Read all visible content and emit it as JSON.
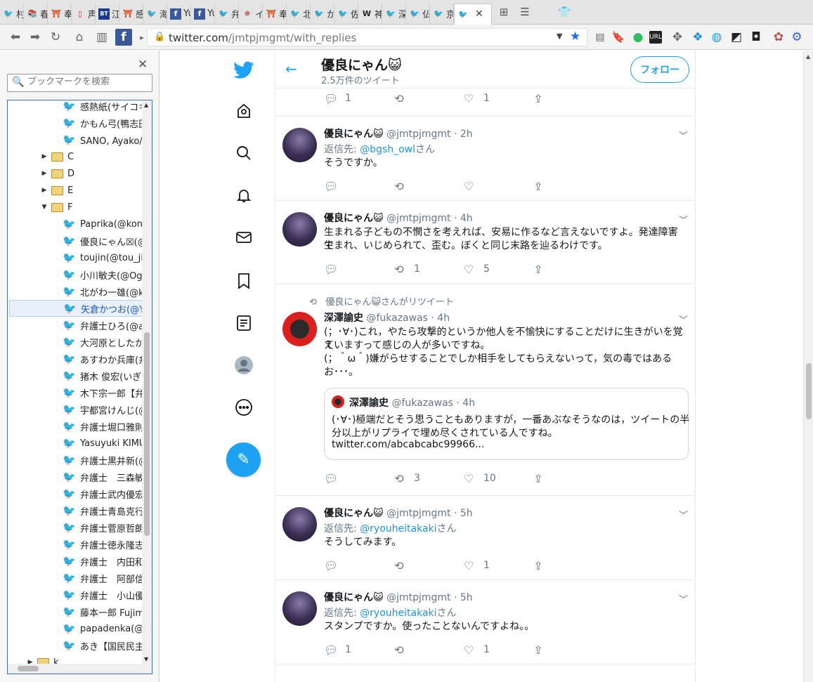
{
  "browser": {
    "tabs": [
      {
        "label": "村松",
        "icon": "twitter-icon"
      },
      {
        "label": "春日",
        "icon": "book-icon"
      },
      {
        "label": "奉納",
        "icon": "shrine-icon"
      },
      {
        "label": "声明",
        "icon": "page-icon"
      },
      {
        "label": "江川",
        "icon": "bt-icon"
      },
      {
        "label": "感熱",
        "icon": "shrine-icon"
      },
      {
        "label": "海派",
        "icon": "twitter-icon"
      },
      {
        "label": "Yui",
        "icon": "facebook-icon"
      },
      {
        "label": "Yui",
        "icon": "facebook-icon"
      },
      {
        "label": "弁護",
        "icon": "twitter-icon"
      },
      {
        "label": "イタ",
        "icon": "crest-icon"
      },
      {
        "label": "奉納",
        "icon": "shrine-icon"
      },
      {
        "label": "北氏",
        "icon": "twitter-icon"
      },
      {
        "label": "かの",
        "icon": "twitter-icon"
      },
      {
        "label": "佐藤",
        "icon": "twitter-icon"
      },
      {
        "label": "神山",
        "icon": "wikipedia-icon"
      },
      {
        "label": "深澤",
        "icon": "twitter-icon"
      },
      {
        "label": "仏教",
        "icon": "twitter-icon"
      },
      {
        "label": "京ア",
        "icon": "twitter-icon"
      }
    ],
    "url_host": "twitter.com",
    "url_path": "/jmtpjmgmt/with_replies"
  },
  "sidebar": {
    "search_placeholder": "ブックマークを検索",
    "items": [
      {
        "type": "bookmark",
        "label": "感熱紙(サイコキ"
      },
      {
        "type": "bookmark",
        "label": "かもん弓(鴨志田"
      },
      {
        "type": "bookmark",
        "label": "SANO, Ayako/佐"
      },
      {
        "type": "folder",
        "label": "C"
      },
      {
        "type": "folder",
        "label": "D"
      },
      {
        "type": "folder",
        "label": "E"
      },
      {
        "type": "folder-open",
        "label": "F"
      },
      {
        "type": "bookmark",
        "label": "Paprika(@konn"
      },
      {
        "type": "bookmark",
        "label": "優良にゃん☒(@"
      },
      {
        "type": "bookmark",
        "label": "toujin(@tou_jin"
      },
      {
        "type": "bookmark",
        "label": "小川敏夫(@Oga"
      },
      {
        "type": "bookmark",
        "label": "北がわ一雄(@k"
      },
      {
        "type": "bookmark-selected",
        "label": "矢倉かつお(@Ya"
      },
      {
        "type": "bookmark",
        "label": "弁護士ひろ(@ad"
      },
      {
        "type": "bookmark",
        "label": "大河原としたか("
      },
      {
        "type": "bookmark",
        "label": "あすわか兵庫(弁"
      },
      {
        "type": "bookmark",
        "label": "猪木 俊宏(いぎ"
      },
      {
        "type": "bookmark",
        "label": "木下宗一郎【弁護"
      },
      {
        "type": "bookmark",
        "label": "宇都宮けんじ(@"
      },
      {
        "type": "bookmark",
        "label": "弁護士堀口雅則"
      },
      {
        "type": "bookmark",
        "label": "Yasuyuki KIMU"
      },
      {
        "type": "bookmark",
        "label": "弁護士黒井新(@"
      },
      {
        "type": "bookmark",
        "label": "弁護士　三森敏"
      },
      {
        "type": "bookmark",
        "label": "弁護士武内優宏"
      },
      {
        "type": "bookmark",
        "label": "弁護士青島克行"
      },
      {
        "type": "bookmark",
        "label": "弁護士菅原哲朗"
      },
      {
        "type": "bookmark",
        "label": "弁護士徳永隆志"
      },
      {
        "type": "bookmark",
        "label": "弁護士　内田和"
      },
      {
        "type": "bookmark",
        "label": "弁護士　阿部信"
      },
      {
        "type": "bookmark",
        "label": "弁護士　小山優"
      },
      {
        "type": "bookmark",
        "label": "藤本一郎 Fujim"
      },
      {
        "type": "bookmark",
        "label": "papadenka(@h"
      },
      {
        "type": "bookmark",
        "label": "あき【国民民主党"
      },
      {
        "type": "folder-root",
        "label": "k"
      }
    ]
  },
  "profile": {
    "name": "優良にゃん😺",
    "tweet_count": "2.5万件のツイート",
    "follow_label": "フォロー"
  },
  "tweets": [
    {
      "kind": "partial",
      "reply_count": "1",
      "retweet_count": "",
      "like_count": "1"
    },
    {
      "kind": "reply",
      "name": "優良にゃん😺",
      "handle": "@jmtpjmgmt",
      "time": "· 2h",
      "reply_prefix": "返信先: ",
      "reply_to": "@bgsh_owl",
      "reply_suffix": "さん",
      "lines": [
        "そうですか。"
      ],
      "reply_count": "",
      "retweet_count": "",
      "like_count": ""
    },
    {
      "kind": "tweet",
      "name": "優良にゃん😺",
      "handle": "@jmtpjmgmt",
      "time": "· 4h",
      "lines": [
        "生まれる子どもの不憫さを考えれば、安易に作るなど言えないですよ。発達障害で",
        "生まれ、いじめられて、歪む。ぼくと同じ末路を辿るわけです。"
      ],
      "reply_count": "",
      "retweet_count": "1",
      "like_count": "5"
    },
    {
      "kind": "retweet",
      "retweet_label": "優良にゃん😺さんがリツイート",
      "name": "深澤諭史",
      "handle": "@fukazawas",
      "time": "· 4h",
      "lines": [
        "(；･∀･)これ，やたら攻撃的というか他人を不愉快にすることだけに生きがいを覚え",
        "ていますって感じの人が多いですね。",
        "(；＾ω＾)嫌がらせすることでしか相手をしてもらえないって，気の毒ではある",
        "お･･･。"
      ],
      "quote": {
        "name": "深澤諭史",
        "handle": "@fukazawas",
        "time": "· 4h",
        "lines": [
          "(･∀･)極端だとそう思うこともありますが，一番あぶなそうなのは，ツイートの半",
          "分以上がリプライで埋め尽くされている人ですね。",
          "twitter.com/abcabcabc99966..."
        ]
      },
      "reply_count": "",
      "retweet_count": "3",
      "like_count": "10"
    },
    {
      "kind": "reply",
      "name": "優良にゃん😺",
      "handle": "@jmtpjmgmt",
      "time": "· 5h",
      "reply_prefix": "返信先: ",
      "reply_to": "@ryouheitakaki",
      "reply_suffix": "さん",
      "lines": [
        "そうしてみます。"
      ],
      "reply_count": "",
      "retweet_count": "",
      "like_count": "1"
    },
    {
      "kind": "reply",
      "name": "優良にゃん😺",
      "handle": "@jmtpjmgmt",
      "time": "· 5h",
      "reply_prefix": "返信先: ",
      "reply_to": "@ryouheitakaki",
      "reply_suffix": "さん",
      "lines": [
        "スタンプですか。使ったことないんですよね。。"
      ],
      "reply_count": "1",
      "retweet_count": "",
      "like_count": "1"
    }
  ],
  "colors": {
    "twitter_blue": "#1da1f2",
    "text_gray": "#657786",
    "link_blue": "#1b95e0"
  }
}
